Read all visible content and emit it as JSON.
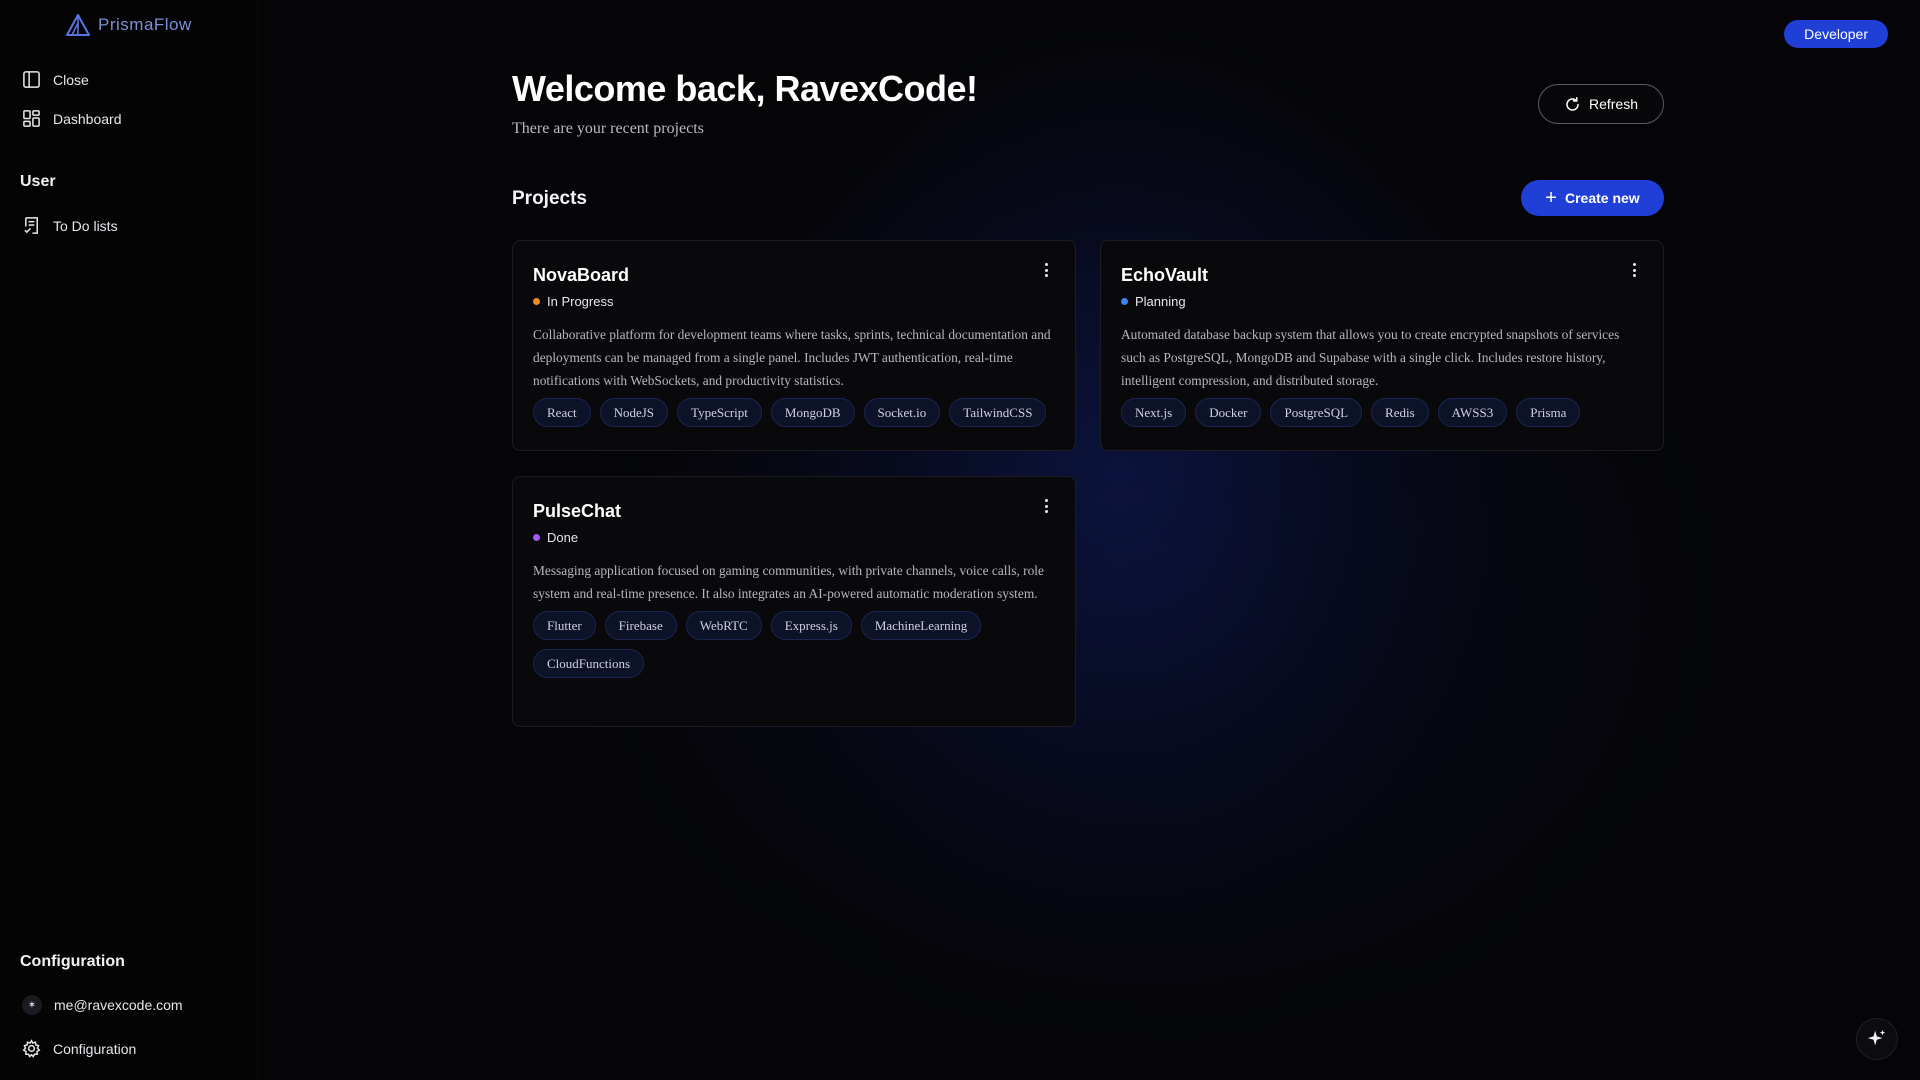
{
  "brand": {
    "name": "PrismaFlow"
  },
  "sidebar": {
    "top_items": [
      {
        "label": "Close",
        "icon": "sidebar-panel-icon"
      },
      {
        "label": "Dashboard",
        "icon": "dashboard-grid-icon"
      }
    ],
    "user_section": {
      "label": "User",
      "items": [
        {
          "label": "To Do lists",
          "icon": "clipboard-list-icon"
        }
      ]
    },
    "config_section": {
      "label": "Configuration",
      "email": "me@ravexcode.com",
      "items": [
        {
          "label": "Configuration",
          "icon": "gear-icon"
        }
      ]
    }
  },
  "header": {
    "role_button": "Developer",
    "title": "Welcome back, RavexCode!",
    "subtitle": "There are your recent projects",
    "refresh_label": "Refresh"
  },
  "projects": {
    "title": "Projects",
    "create_label": "Create new",
    "items": [
      {
        "name": "NovaBoard",
        "status": "In Progress",
        "status_color": "#f08a24",
        "description": "Collaborative platform for development teams where tasks, sprints, technical documentation and deployments can be managed from a single panel. Includes JWT authentication, real-time notifications with WebSockets, and productivity statistics.",
        "tags": [
          "React",
          "NodeJS",
          "TypeScript",
          "MongoDB",
          "Socket.io",
          "TailwindCSS"
        ]
      },
      {
        "name": "EchoVault",
        "status": "Planning",
        "status_color": "#3b82f6",
        "description": "Automated database backup system that allows you to create encrypted snapshots of services such as PostgreSQL, MongoDB and Supabase with a single click. Includes restore history, intelligent compression, and distributed storage.",
        "tags": [
          "Next.js",
          "Docker",
          "PostgreSQL",
          "Redis",
          "AWSS3",
          "Prisma"
        ]
      },
      {
        "name": "PulseChat",
        "status": "Done",
        "status_color": "#a855f7",
        "description": "Messaging application focused on gaming communities, with private channels, voice calls, role system and real-time presence. It also integrates an AI-powered automatic moderation system.",
        "tags": [
          "Flutter",
          "Firebase",
          "WebRTC",
          "Express.js",
          "MachineLearning",
          "CloudFunctions"
        ]
      }
    ]
  },
  "colors": {
    "accent": "#1f3fd6",
    "background": "#050507",
    "card": "#09090c"
  }
}
